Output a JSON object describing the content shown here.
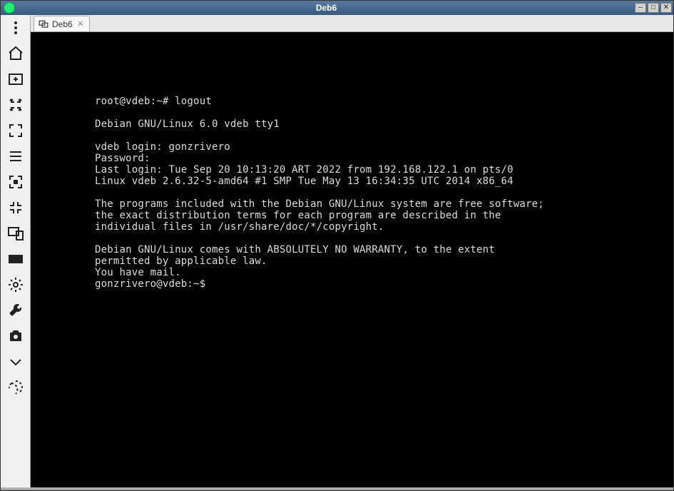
{
  "window": {
    "title": "Deb6"
  },
  "tab": {
    "label": "Deb6"
  },
  "toolbar": {
    "items": [
      "drag-handle-icon",
      "home-icon",
      "add-screen-icon",
      "switch-session-icon",
      "focus-icon",
      "list-icon",
      "fullscreen-enter-icon",
      "fullscreen-exit-icon",
      "devices-icon",
      "keyboard-icon",
      "settings-icon",
      "tools-icon",
      "screenshot-icon",
      "chevron-down-icon",
      "disconnect-icon"
    ]
  },
  "terminal": {
    "lines": [
      "root@vdeb:~# logout",
      "",
      "Debian GNU/Linux 6.0 vdeb tty1",
      "",
      "vdeb login: gonzrivero",
      "Password:",
      "Last login: Tue Sep 20 10:13:20 ART 2022 from 192.168.122.1 on pts/0",
      "Linux vdeb 2.6.32-5-amd64 #1 SMP Tue May 13 16:34:35 UTC 2014 x86_64",
      "",
      "The programs included with the Debian GNU/Linux system are free software;",
      "the exact distribution terms for each program are described in the",
      "individual files in /usr/share/doc/*/copyright.",
      "",
      "Debian GNU/Linux comes with ABSOLUTELY NO WARRANTY, to the extent",
      "permitted by applicable law.",
      "You have mail.",
      "gonzrivero@vdeb:~$ "
    ]
  }
}
